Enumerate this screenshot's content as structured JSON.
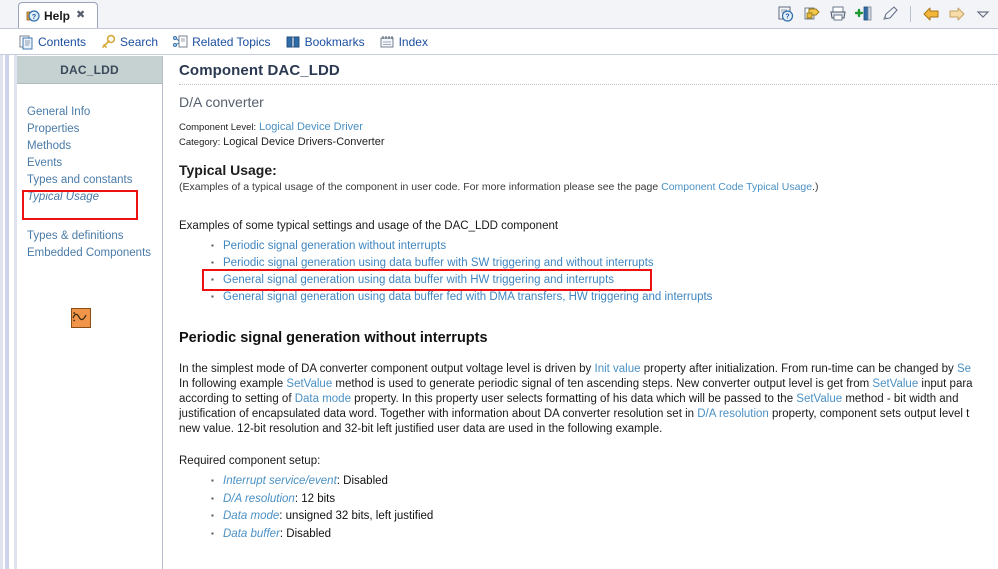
{
  "window": {
    "tab": {
      "label": "Help",
      "icon": "help-icon",
      "close_glyph": "✖"
    },
    "toolbar_icons": [
      {
        "name": "help-search-icon",
        "glyph": "?"
      },
      {
        "name": "refresh-sync-icon",
        "glyph": "↻"
      },
      {
        "name": "print-icon",
        "glyph": "⎙"
      },
      {
        "name": "add-bookmark-icon",
        "glyph": "+"
      },
      {
        "name": "highlighter-icon",
        "glyph": "✐"
      },
      {
        "name": "back-arrow-icon",
        "glyph": "⇦"
      },
      {
        "name": "forward-arrow-icon",
        "glyph": "⇨"
      },
      {
        "name": "chevron-down-icon",
        "glyph": "▽"
      }
    ]
  },
  "menu": {
    "items": [
      {
        "label": "Contents",
        "icon": "contents-icon"
      },
      {
        "label": "Search",
        "icon": "search-key-icon"
      },
      {
        "label": "Related Topics",
        "icon": "related-topics-icon"
      },
      {
        "label": "Bookmarks",
        "icon": "bookmarks-book-icon"
      },
      {
        "label": "Index",
        "icon": "index-icon"
      }
    ]
  },
  "sidebar": {
    "header": "DAC_LDD",
    "items": [
      {
        "label": "General Info",
        "italic": false
      },
      {
        "label": "Properties",
        "italic": false
      },
      {
        "label": "Methods",
        "italic": false
      },
      {
        "label": "Events",
        "italic": false
      },
      {
        "label": "Types and constants",
        "italic": false
      },
      {
        "label": "Typical Usage",
        "italic": true
      }
    ],
    "items2": [
      {
        "label": "Types & definitions"
      },
      {
        "label": "Embedded Components"
      }
    ],
    "component_icon": "dac-waveform-icon"
  },
  "content": {
    "title": "Component DAC_LDD",
    "subtitle": "D/A converter",
    "component_level_label": "Component Level",
    "component_level_value": "Logical Device Driver",
    "category_label": "Category",
    "category_value": "Logical Device Drivers-Converter",
    "typical_usage_heading": "Typical Usage:",
    "typical_usage_note_pre": "(Examples of a typical usage of the component in user code. For more information please see the page ",
    "typical_usage_note_link": "Component Code Typical Usage",
    "typical_usage_note_post": ".)",
    "examples_intro": "Examples of some typical settings and usage of the DAC_LDD component",
    "example_links": [
      "Periodic signal generation without interrupts",
      "Periodic signal generation using data buffer with SW triggering and without interrupts",
      "General signal generation using data buffer with HW triggering and interrupts",
      "General signal generation using data buffer fed with DMA transfers, HW triggering and interrupts"
    ],
    "section_heading": "Periodic signal generation without interrupts",
    "paragraph_lines": [
      {
        "parts": [
          {
            "t": "In the simplest mode of DA converter component output voltage level is driven by ",
            "s": "plain"
          },
          {
            "t": "Init value",
            "s": "link"
          },
          {
            "t": " property after initialization. From run-time can be changed by ",
            "s": "plain"
          },
          {
            "t": "Se",
            "s": "link"
          }
        ]
      },
      {
        "parts": [
          {
            "t": "In following example ",
            "s": "plain"
          },
          {
            "t": "SetValue",
            "s": "link"
          },
          {
            "t": " method is used to generate periodic signal of ten ascending steps. New converter output level is get from ",
            "s": "plain"
          },
          {
            "t": "SetValue",
            "s": "link"
          },
          {
            "t": " input para",
            "s": "plain"
          }
        ]
      },
      {
        "parts": [
          {
            "t": "according to setting of ",
            "s": "plain"
          },
          {
            "t": "Data mode",
            "s": "link"
          },
          {
            "t": " property. In this property user selects formatting of his data which will be passed to the ",
            "s": "plain"
          },
          {
            "t": "SetValue",
            "s": "link"
          },
          {
            "t": " method - bit width and",
            "s": "plain"
          }
        ]
      },
      {
        "parts": [
          {
            "t": "justification of encapsulated data word. Together with information about DA converter resolution set in ",
            "s": "plain"
          },
          {
            "t": "D/A resolution",
            "s": "link"
          },
          {
            "t": " property, component sets output level t",
            "s": "plain"
          }
        ]
      },
      {
        "parts": [
          {
            "t": "new value. 12-bit resolution and 32-bit left justified user data are used in the following example.",
            "s": "plain"
          }
        ]
      }
    ],
    "required_setup_label": "Required component setup:",
    "setup_items": [
      {
        "name": "Interrupt service/event",
        "value": "Disabled"
      },
      {
        "name": "D/A resolution",
        "value": "12 bits"
      },
      {
        "name": "Data mode",
        "value": "unsigned 32 bits, left justified"
      },
      {
        "name": "Data buffer",
        "value": "Disabled"
      }
    ]
  },
  "annotations": {
    "sidebar_box_color": "#ee1111",
    "content_box_color": "#ee1111"
  }
}
